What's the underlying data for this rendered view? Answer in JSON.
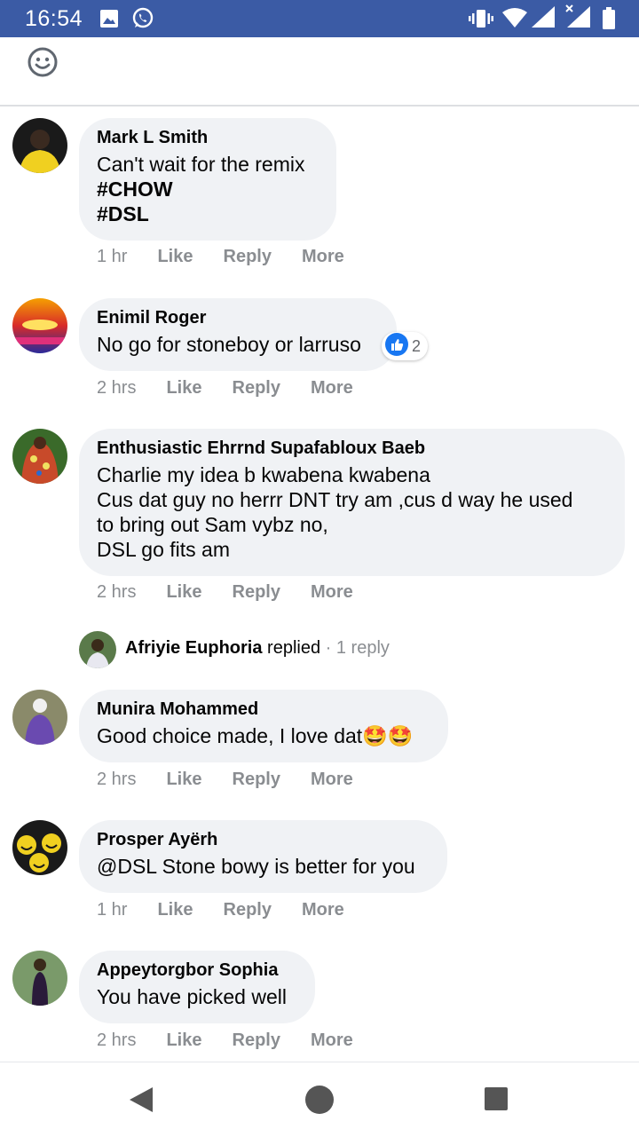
{
  "status_bar": {
    "time": "16:54",
    "left_icons": [
      "image-icon",
      "whatsapp-icon"
    ],
    "right_icons": [
      "vibrate-icon",
      "wifi-icon",
      "signal-icon",
      "signal-x-icon",
      "battery-icon"
    ]
  },
  "top_bar": {
    "icon": "smiley-icon"
  },
  "comments": [
    {
      "author": "Mark L Smith",
      "text_lines": [
        "Can't wait for the remix",
        "#CHOW",
        "#DSL"
      ],
      "time": "1 hr",
      "like": "Like",
      "reply": "Reply",
      "more": "More"
    },
    {
      "author": "Enimil Roger",
      "text_lines": [
        "No go for stoneboy or larruso"
      ],
      "reaction_count": "2",
      "time": "2 hrs",
      "like": "Like",
      "reply": "Reply",
      "more": "More"
    },
    {
      "author": "Enthusiastic Ehrrnd Supafabloux Baeb",
      "text_lines": [
        "Charlie my idea b kwabena kwabena",
        "Cus dat guy no herrr DNT try am ,cus d way he used",
        "to bring out Sam vybz no,",
        "DSL go fits am"
      ],
      "time": "2 hrs",
      "like": "Like",
      "reply": "Reply",
      "more": "More",
      "reply_summary": {
        "name": "Afriyie Euphoria",
        "verb": "replied",
        "sep": " · ",
        "count": "1 reply"
      }
    },
    {
      "author": "Munira Mohammed",
      "text_lines": [
        "Good choice made, I love dat🤩🤩"
      ],
      "time": "2 hrs",
      "like": "Like",
      "reply": "Reply",
      "more": "More"
    },
    {
      "author": "Prosper Ayërh",
      "text_lines": [
        "@DSL Stone bowy is better for you"
      ],
      "time": "1 hr",
      "like": "Like",
      "reply": "Reply",
      "more": "More"
    },
    {
      "author": "Appeytorgbor Sophia",
      "text_lines": [
        "You have picked well"
      ],
      "time": "2 hrs",
      "like": "Like",
      "reply": "Reply",
      "more": "More"
    }
  ],
  "nav_bar": {
    "buttons": [
      "back-icon",
      "home-icon",
      "recents-icon"
    ]
  },
  "colors": {
    "status_bar": "#3b5ba5",
    "bubble": "#f0f2f5",
    "meta_text": "#8a8d91",
    "like_reaction": "#1877f2"
  }
}
